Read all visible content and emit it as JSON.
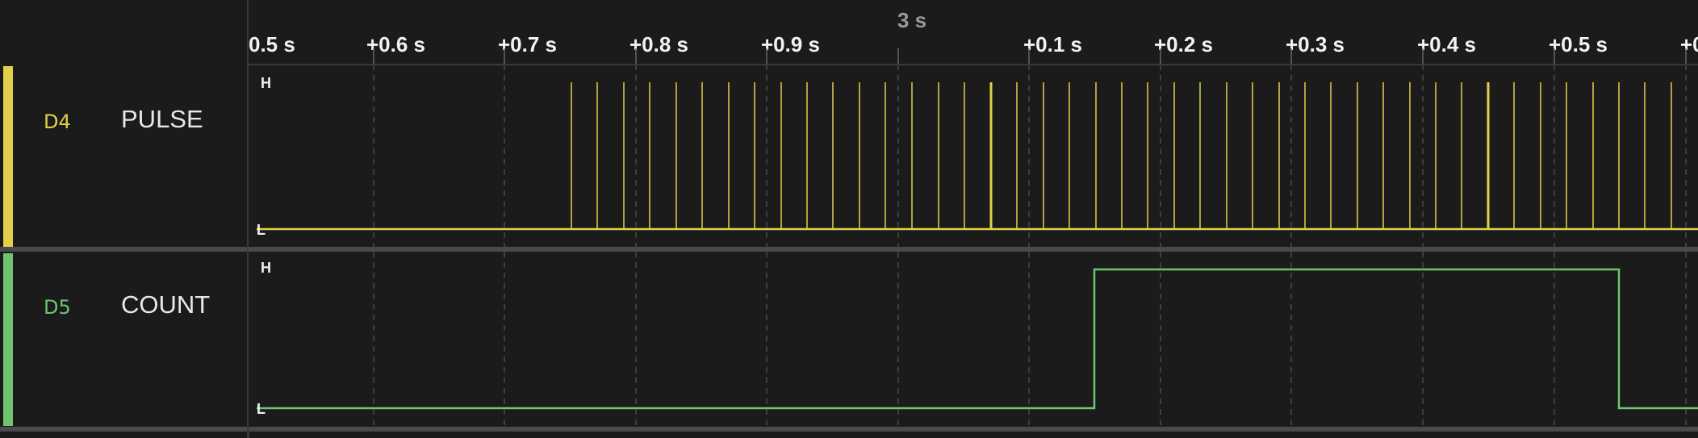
{
  "timeline": {
    "major_label": "3 s",
    "ticks": [
      "0.5 s",
      "+0.6 s",
      "+0.7 s",
      "+0.8 s",
      "+0.9 s",
      "+0.1 s",
      "+0.2 s",
      "+0.3 s",
      "+0.4 s",
      "+0.5 s",
      "+0"
    ]
  },
  "channels": [
    {
      "id": "D4",
      "name": "PULSE",
      "color": "#e2d04a",
      "high_label": "H",
      "low_label": "L"
    },
    {
      "id": "D5",
      "name": "COUNT",
      "color": "#6fc46f",
      "high_label": "H",
      "low_label": "L"
    }
  ],
  "colors": {
    "background": "#1b1b1c",
    "grid": "#4a4a4a",
    "separator": "#4a4a4e"
  }
}
